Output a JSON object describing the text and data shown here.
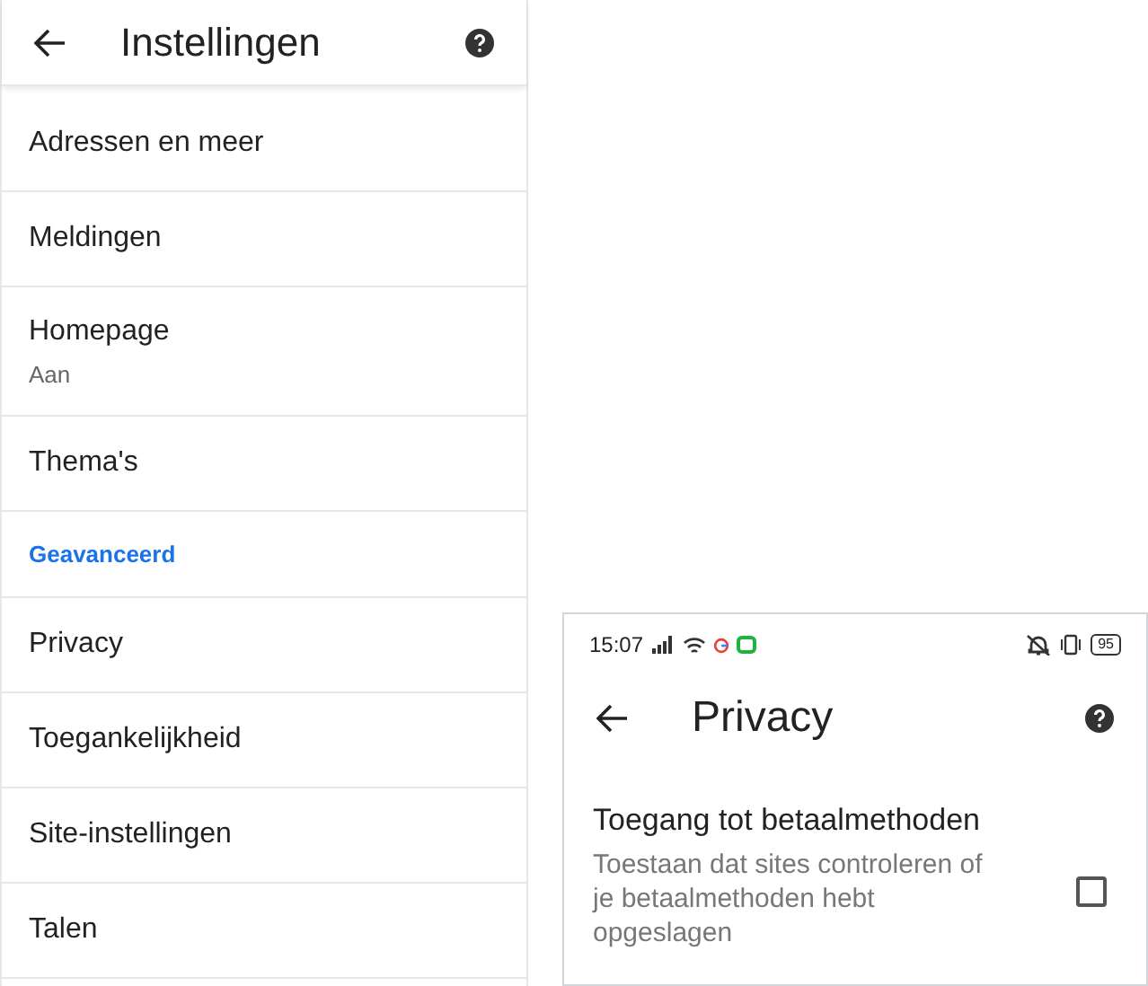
{
  "settings": {
    "title": "Instellingen",
    "items": [
      {
        "kind": "item",
        "label": "Adressen en meer"
      },
      {
        "kind": "item",
        "label": "Meldingen"
      },
      {
        "kind": "item",
        "label": "Homepage",
        "subtitle": "Aan"
      },
      {
        "kind": "item",
        "label": "Thema's"
      },
      {
        "kind": "section",
        "label": "Geavanceerd"
      },
      {
        "kind": "item",
        "label": "Privacy"
      },
      {
        "kind": "item",
        "label": "Toegankelijkheid"
      },
      {
        "kind": "item",
        "label": "Site-instellingen"
      },
      {
        "kind": "item",
        "label": "Talen"
      }
    ]
  },
  "privacy": {
    "status_bar": {
      "time": "15:07",
      "battery": "95"
    },
    "title": "Privacy",
    "option": {
      "title": "Toegang tot betaalmethoden",
      "description": "Toestaan dat sites controleren of je betaalmethoden hebt opgeslagen",
      "checked": false
    }
  }
}
